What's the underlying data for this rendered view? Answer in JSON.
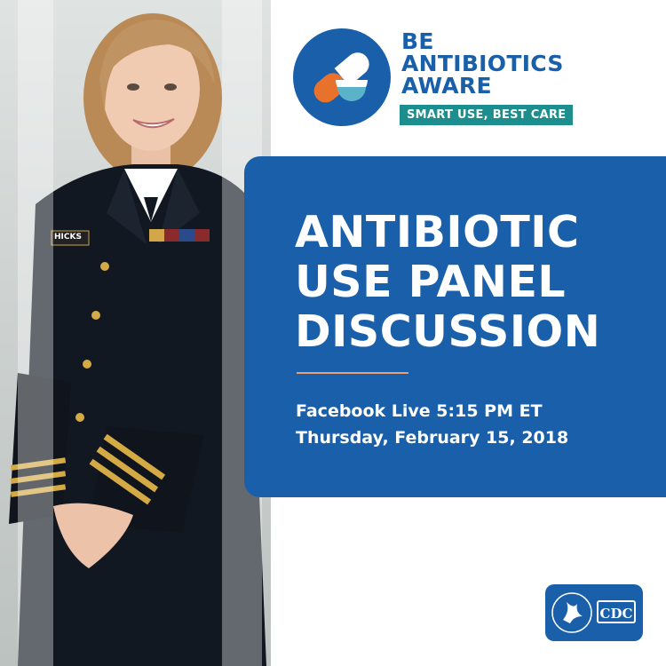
{
  "logo": {
    "line1": "BE",
    "line2": "ANTIBIOTICS",
    "line3": "AWARE",
    "tagline": "SMART USE, BEST CARE"
  },
  "headline": {
    "line1": "ANTIBIOTIC",
    "line2": "USE PANEL",
    "line3": "DISCUSSION"
  },
  "event": {
    "line1": "Facebook Live 5:15 PM ET",
    "line2": "Thursday, February 15, 2018"
  },
  "photo": {
    "name_tag": "HICKS"
  },
  "cdc": {
    "label": "CDC"
  },
  "colors": {
    "brand_blue": "#1a5fa9",
    "teal": "#1b8e8d",
    "orange": "#e8722c",
    "accent_line": "#e8a070"
  }
}
